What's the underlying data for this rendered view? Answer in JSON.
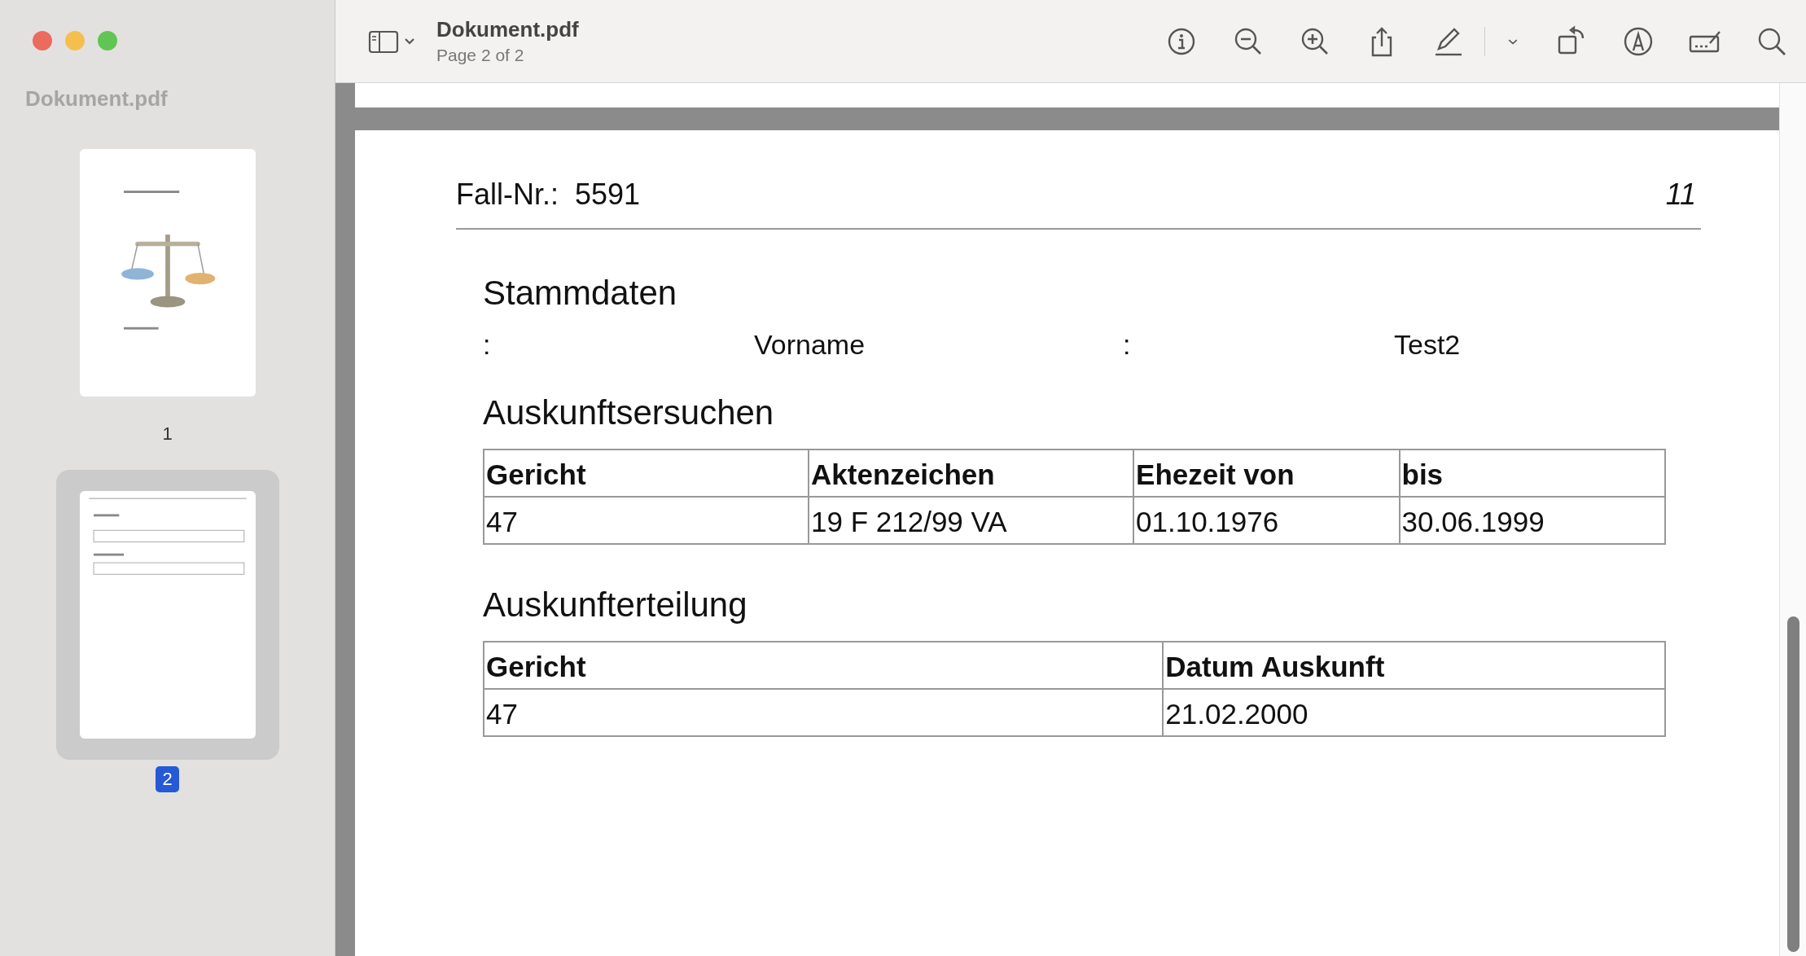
{
  "window": {
    "title": "Dokument.pdf",
    "subtitle": "Page 2 of 2"
  },
  "sidebar": {
    "title": "Dokument.pdf",
    "pages": [
      {
        "label": "1",
        "selected": false,
        "kind": "picture"
      },
      {
        "label": "2",
        "selected": true,
        "kind": "picture"
      }
    ]
  },
  "document": {
    "case_label": "Fall-Nr.:",
    "case_number": "5591",
    "page_number": "11",
    "sections": [
      {
        "kind": "fields",
        "heading": "Stammdaten",
        "cells": [
          ":",
          "Vorname",
          ":",
          "Test2"
        ]
      },
      {
        "kind": "table",
        "heading": "Auskunftsersuchen",
        "columns": [
          "Gericht",
          "Aktenzeichen",
          "Ehezeit von",
          "bis"
        ],
        "rows": [
          [
            "47",
            "19 F 212/99 VA",
            "01.10.1976",
            "30.06.1999"
          ]
        ]
      },
      {
        "kind": "table",
        "heading": "Auskunfterteilung",
        "columns": [
          "Gericht",
          "Datum Auskunft"
        ],
        "rows": [
          [
            "47",
            "21.02.2000"
          ]
        ]
      }
    ]
  }
}
